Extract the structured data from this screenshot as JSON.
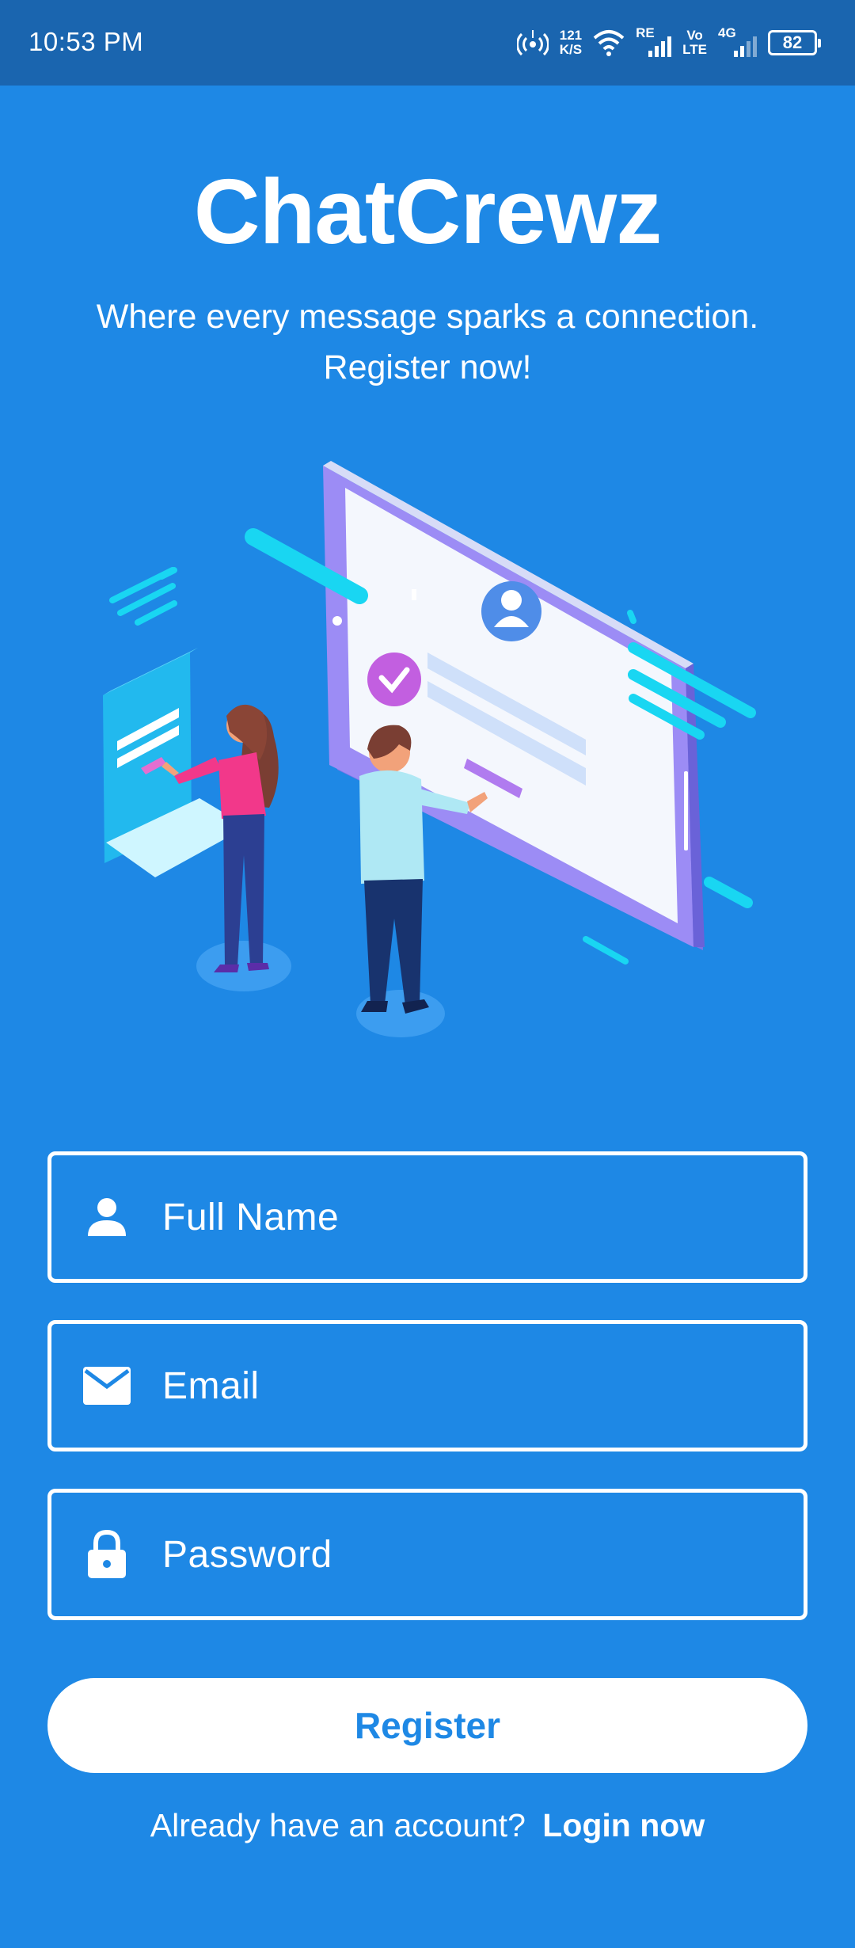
{
  "status_bar": {
    "time": "10:53 PM",
    "net_speed_value": "121",
    "net_speed_unit": "K/S",
    "carrier_label": "RE",
    "volte_top": "Vo",
    "volte_bottom": "LTE",
    "network_type": "4G",
    "battery_level": "82"
  },
  "header": {
    "title": "ChatCrewz",
    "tagline_line1": "Where every message sparks a connection.",
    "tagline_line2": "Register now!"
  },
  "form": {
    "full_name": {
      "value": "",
      "placeholder": "Full Name",
      "icon": "person-icon"
    },
    "email": {
      "value": "",
      "placeholder": "Email",
      "icon": "mail-icon"
    },
    "password": {
      "value": "",
      "placeholder": "Password",
      "icon": "lock-icon"
    },
    "register_label": "Register"
  },
  "footer": {
    "prompt": "Already have an account?",
    "login_label": "Login now"
  },
  "colors": {
    "background": "#1E88E5",
    "status_bar": "#1A65AF",
    "button_background": "#FFFFFF",
    "button_text": "#1E88E5"
  }
}
